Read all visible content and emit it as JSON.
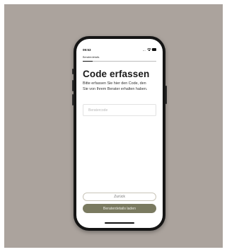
{
  "status_bar": {
    "time": "09:53",
    "signal_dots": "...",
    "wifi_icon": "wifi-icon",
    "battery_icon": "battery-icon"
  },
  "nav": {
    "title": "Beraterdetails"
  },
  "main": {
    "title": "Code erfassen",
    "description": "Bitte erfassen Sie hier den Code, den Sie von Ihrem Berater erhalten haben.",
    "code_input": {
      "value": "",
      "placeholder": "Beratercode"
    }
  },
  "buttons": {
    "back_label": "Zurück",
    "load_label": "Beraterdetails laden"
  },
  "colors": {
    "background": "#aba39d",
    "primary_button": "#7a7a60",
    "secondary_border": "#c8c4b8"
  }
}
